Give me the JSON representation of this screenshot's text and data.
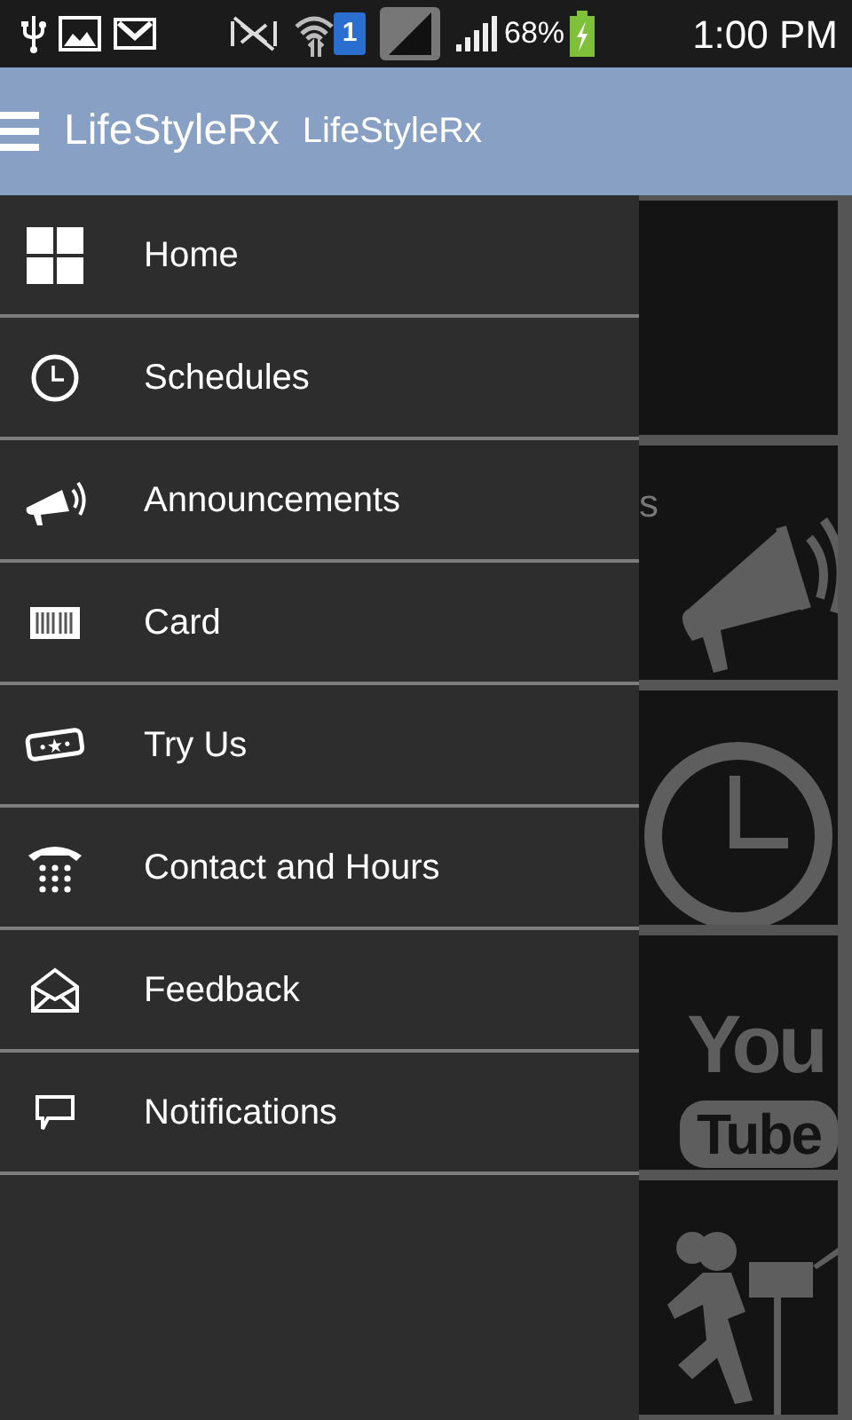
{
  "status_bar": {
    "sim_label": "1",
    "battery": "68%",
    "time": "1:00 PM"
  },
  "app_bar": {
    "title": "LifeStyleRx",
    "subtitle": "LifeStyleRx"
  },
  "tiles": [
    {
      "kind": "blank"
    },
    {
      "kind": "megaphone",
      "label": "s"
    },
    {
      "kind": "clock"
    },
    {
      "kind": "video",
      "logo_top": "You",
      "logo_bottom": "Tube"
    },
    {
      "kind": "runner"
    }
  ],
  "drawer": {
    "items": [
      {
        "kind": "home",
        "label": "Home"
      },
      {
        "kind": "clock",
        "label": "Schedules"
      },
      {
        "kind": "megaphone",
        "label": "Announcements"
      },
      {
        "kind": "card",
        "label": "Card"
      },
      {
        "kind": "ticket",
        "label": "Try Us"
      },
      {
        "kind": "phone",
        "label": "Contact and Hours"
      },
      {
        "kind": "envelope",
        "label": "Feedback"
      },
      {
        "kind": "chat",
        "label": "Notifications"
      }
    ]
  }
}
